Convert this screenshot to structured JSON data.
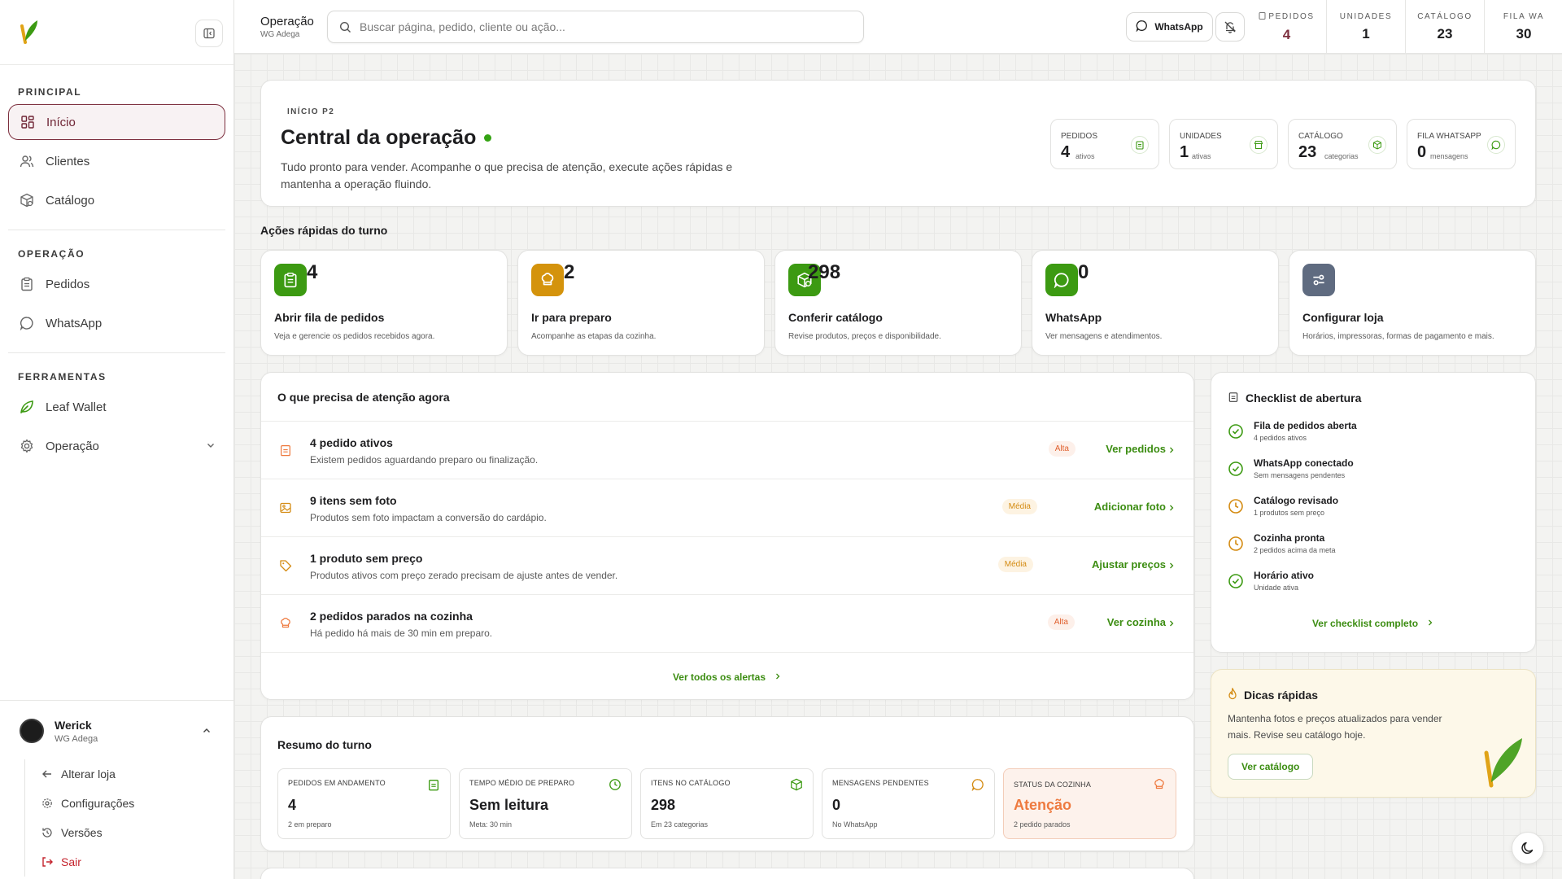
{
  "sidebar": {
    "sections": [
      {
        "label": "PRINCIPAL",
        "items": [
          {
            "label": "Início",
            "icon": "grid-icon",
            "active": true
          },
          {
            "label": "Clientes",
            "icon": "users-icon"
          },
          {
            "label": "Catálogo",
            "icon": "package-icon"
          }
        ]
      },
      {
        "label": "OPERAÇÃO",
        "items": [
          {
            "label": "Pedidos",
            "icon": "clipboard-icon"
          },
          {
            "label": "WhatsApp",
            "icon": "chat-icon"
          }
        ]
      },
      {
        "label": "FERRAMENTAS",
        "items": [
          {
            "label": "Leaf Wallet",
            "icon": "leaf-icon"
          },
          {
            "label": "Operação",
            "icon": "gear-icon"
          }
        ]
      }
    ],
    "user": {
      "name": "Werick",
      "store": "WG Adega"
    },
    "user_menu": {
      "change_store": "Alterar loja",
      "settings": "Configurações",
      "versions": "Versões",
      "logout": "Sair"
    }
  },
  "header": {
    "title": "Operação",
    "subtitle": "WG Adega",
    "search_placeholder": "Buscar página, pedido, cliente ou ação...",
    "whatsapp_label": "WhatsApp",
    "stats": [
      {
        "label": "PEDIDOS",
        "value": "4"
      },
      {
        "label": "UNIDADES",
        "value": "1"
      },
      {
        "label": "CATÁLOGO",
        "value": "23"
      },
      {
        "label": "FILA WA",
        "value": "30"
      }
    ]
  },
  "hero": {
    "eyebrow": "INÍCIO P2",
    "title": "Central da operação",
    "description": "Tudo pronto para vender. Acompanhe o que precisa de atenção, execute ações rápidas e mantenha a operação fluindo.",
    "stats": [
      {
        "label": "PEDIDOS",
        "value": "4",
        "unit": "ativos"
      },
      {
        "label": "UNIDADES",
        "value": "1",
        "unit": "ativas"
      },
      {
        "label": "CATÁLOGO",
        "value": "23",
        "unit": "categorias"
      },
      {
        "label": "FILA WHATSAPP",
        "value": "0",
        "unit": "mensagens"
      }
    ]
  },
  "quick_actions": {
    "title": "Ações rápidas do turno",
    "items": [
      {
        "count": "4",
        "title": "Abrir fila de pedidos",
        "desc": "Veja e gerencie os pedidos recebidos agora.",
        "color": "#3c9a12"
      },
      {
        "count": "2",
        "title": "Ir para preparo",
        "desc": "Acompanhe as etapas da cozinha.",
        "color": "#d4930c"
      },
      {
        "count": "298",
        "title": "Conferir catálogo",
        "desc": "Revise produtos, preços e disponibilidade.",
        "color": "#3c9a12"
      },
      {
        "count": "0",
        "title": "WhatsApp",
        "desc": "Ver mensagens e atendimentos.",
        "color": "#3c9a12"
      },
      {
        "count": "",
        "title": "Configurar loja",
        "desc": "Horários, impressoras, formas de pagamento e mais.",
        "color": "#5f6b80"
      }
    ]
  },
  "alerts": {
    "title": "O que precisa de atenção agora",
    "items": [
      {
        "title": "4 pedido ativos",
        "desc": "Existem pedidos aguardando preparo ou finalização.",
        "badge": "Alta",
        "action": "Ver pedidos"
      },
      {
        "title": "9 itens sem foto",
        "desc": "Produtos sem foto impactam a conversão do cardápio.",
        "badge": "Média",
        "action": "Adicionar foto"
      },
      {
        "title": "1 produto sem preço",
        "desc": "Produtos ativos com preço zerado precisam de ajuste antes de vender.",
        "badge": "Média",
        "action": "Ajustar preços"
      },
      {
        "title": "2 pedidos parados na cozinha",
        "desc": "Há pedido há mais de 30 min em preparo.",
        "badge": "Alta",
        "action": "Ver cozinha"
      }
    ],
    "footer": "Ver todos os alertas"
  },
  "checklist": {
    "title": "Checklist de abertura",
    "items": [
      {
        "title": "Fila de pedidos aberta",
        "desc": "4 pedidos ativos",
        "status": "done"
      },
      {
        "title": "WhatsApp conectado",
        "desc": "Sem mensagens pendentes",
        "status": "done"
      },
      {
        "title": "Catálogo revisado",
        "desc": "1 produtos sem preço",
        "status": "pending"
      },
      {
        "title": "Cozinha pronta",
        "desc": "2 pedidos acima da meta",
        "status": "pending"
      },
      {
        "title": "Horário ativo",
        "desc": "Unidade ativa",
        "status": "done"
      }
    ],
    "footer": "Ver checklist completo"
  },
  "tips": {
    "title": "Dicas rápidas",
    "desc": "Mantenha fotos e preços atualizados para vender mais. Revise seu catálogo hoje.",
    "button": "Ver catálogo"
  },
  "summary": {
    "title": "Resumo do turno",
    "items": [
      {
        "label": "PEDIDOS EM ANDAMENTO",
        "value": "4",
        "desc": "2 em preparo"
      },
      {
        "label": "TEMPO MÉDIO DE PREPARO",
        "value": "Sem leitura",
        "desc": "Meta: 30 min"
      },
      {
        "label": "ITENS NO CATÁLOGO",
        "value": "298",
        "desc": "Em 23 categorias"
      },
      {
        "label": "MENSAGENS PENDENTES",
        "value": "0",
        "desc": "No WhatsApp"
      },
      {
        "label": "STATUS DA COZINHA",
        "value": "Atenção",
        "desc": "2 pedido parados"
      }
    ]
  },
  "colors": {
    "brand_green": "#3c8d12",
    "accent_wine": "#7c2e3d",
    "warning_orange": "#ee7a3f",
    "warning_amber": "#d48b12"
  }
}
